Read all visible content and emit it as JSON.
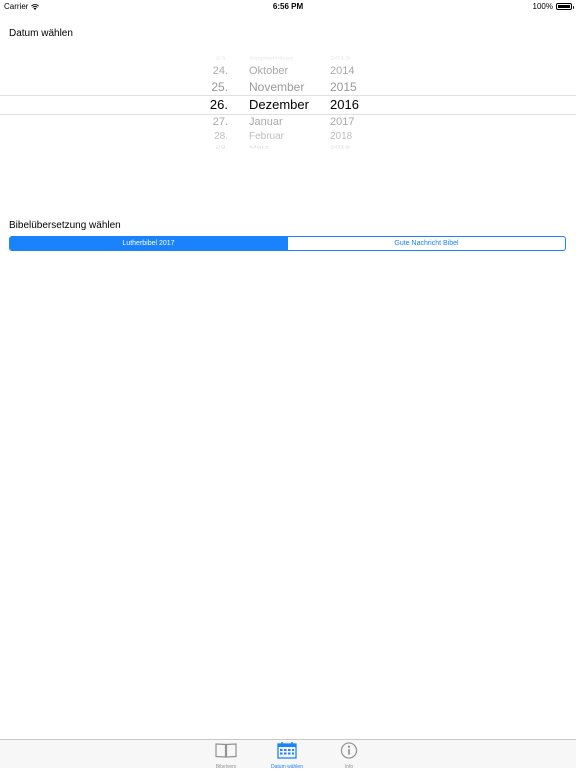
{
  "status_bar": {
    "carrier": "Carrier",
    "time": "6:56 PM",
    "battery": "100%"
  },
  "date_section": {
    "title": "Datum wählen"
  },
  "date_picker": {
    "rows": [
      {
        "day": "23.",
        "month": "September",
        "year": "2013"
      },
      {
        "day": "24.",
        "month": "Oktober",
        "year": "2014"
      },
      {
        "day": "25.",
        "month": "November",
        "year": "2015"
      },
      {
        "day": "26.",
        "month": "Dezember",
        "year": "2016"
      },
      {
        "day": "27.",
        "month": "Januar",
        "year": "2017"
      },
      {
        "day": "28.",
        "month": "Februar",
        "year": "2018"
      },
      {
        "day": "29.",
        "month": "März",
        "year": "2019"
      }
    ],
    "selected": {
      "day": "26.",
      "month": "Dezember",
      "year": "2016"
    }
  },
  "translation_section": {
    "title": "Bibelübersetzung wählen",
    "options": [
      "Lutherbibel 2017",
      "Gute Nachricht Bibel"
    ],
    "selected": "Lutherbibel 2017"
  },
  "tab_bar": {
    "items": [
      {
        "label": "Bibelvers",
        "icon": "book-icon",
        "active": false
      },
      {
        "label": "Datum wählen",
        "icon": "calendar-icon",
        "active": true
      },
      {
        "label": "Info",
        "icon": "info-icon",
        "active": false
      }
    ]
  },
  "colors": {
    "accent": "#1a82fb",
    "inactive": "#929292",
    "tab_background": "#f7f7f7"
  }
}
